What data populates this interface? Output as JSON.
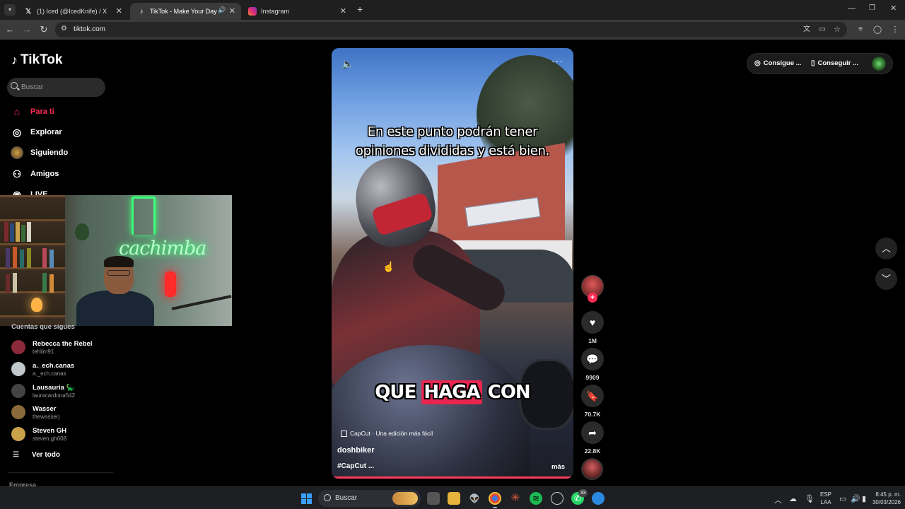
{
  "browser": {
    "tabs": [
      {
        "title": "(1) Iced (@IcedKnife) / X",
        "icon": "x-logo-icon"
      },
      {
        "title": "TikTok - Make Your Day",
        "icon": "tiktok-icon"
      },
      {
        "title": "Instagram",
        "icon": "instagram-icon"
      }
    ],
    "url": "tiktok.com"
  },
  "sidebar": {
    "logo": "TikTok",
    "search_placeholder": "Buscar",
    "nav": [
      {
        "label": "Para ti",
        "icon": "home-icon",
        "active": true
      },
      {
        "label": "Explorar",
        "icon": "compass-icon"
      },
      {
        "label": "Siguiendo",
        "icon": "following-icon"
      },
      {
        "label": "Amigos",
        "icon": "friends-icon"
      },
      {
        "label": "LIVE",
        "icon": "live-icon"
      }
    ],
    "following_title": "Cuentas que sigues",
    "accounts": [
      {
        "name": "Rebecca the Rebel",
        "handle": "tehlim91",
        "color": "#8a2a3a"
      },
      {
        "name": "a._ech.canas",
        "handle": "a._ech.canas",
        "color": "#c0c8cc"
      },
      {
        "name": "Lausauria 🦕",
        "handle": "lauracardona542",
        "color": "#444"
      },
      {
        "name": "Wasser",
        "handle": "thewasserj",
        "color": "#8a6a3a"
      },
      {
        "name": "Steven GH",
        "handle": "steven.gh608",
        "color": "#c9a24a"
      }
    ],
    "see_all": "Ver todo",
    "company": "Empresa"
  },
  "webcam": {
    "neon_text": "cachimba"
  },
  "video": {
    "caption_top_line1": "En este punto podrán tener",
    "caption_top_line2": "opiniones divididas y está bien.",
    "caption_bottom_1": "QUE",
    "caption_bottom_2": "HAGA",
    "caption_bottom_3": "CON",
    "capcut": "CapCut · Una edición más fácil",
    "author": "doshbiker",
    "hashtags": "#CapCut ...",
    "more": "más"
  },
  "actions": {
    "likes": "1M",
    "comments": "9909",
    "saves": "70.7K",
    "shares": "22.8K"
  },
  "topbar": {
    "btn1": "Consigue ...",
    "btn2": "Conseguir ..."
  },
  "taskbar": {
    "search": "Buscar",
    "badge": "33",
    "lang_line1": "ESP",
    "lang_line2": "LAA",
    "time": "8:45 p. m.",
    "date": "30/03/2026"
  }
}
